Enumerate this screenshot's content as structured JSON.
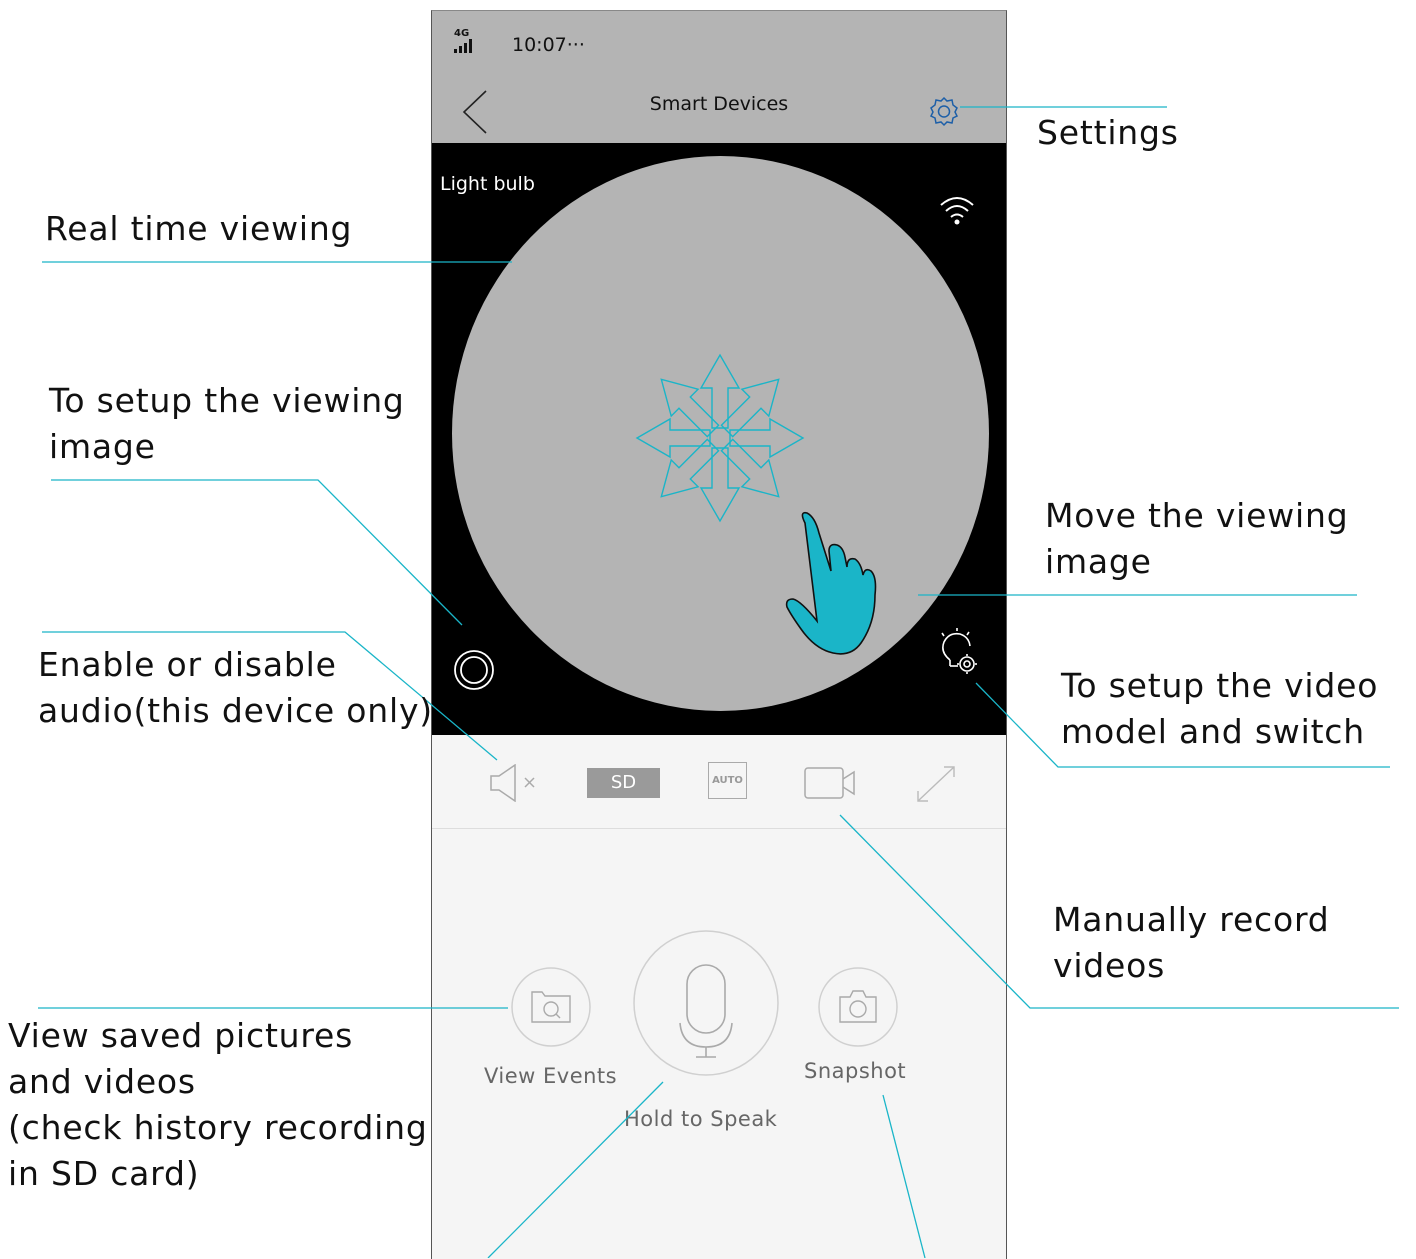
{
  "status_bar": {
    "network": "4G",
    "time": "10:07···"
  },
  "nav": {
    "title": "Smart Devices"
  },
  "video": {
    "device_name": "Light bulb"
  },
  "toolbar": {
    "sd_label": "SD",
    "auto_label": "AUTO"
  },
  "controls": {
    "view_events": "View Events",
    "hold_to_speak": "Hold to Speak",
    "snapshot": "Snapshot"
  },
  "annotations": {
    "settings": "Settings",
    "real_time": "Real time viewing",
    "setup_image_1": "To setup the viewing",
    "setup_image_2": "image",
    "audio_1": "Enable or disable",
    "audio_2": "audio(this device only)",
    "move_1": "Move the viewing",
    "move_2": "image",
    "video_model_1": "To setup the video",
    "video_model_2": "model and switch",
    "record_1": "Manually record",
    "record_2": "videos",
    "saved_1": "View saved pictures",
    "saved_2": "and videos",
    "saved_3": "(check history recording",
    "saved_4": "in SD card)"
  },
  "colors": {
    "accent": "#1ab5c8",
    "header_gray": "#b4b4b4",
    "video_bg": "#000000"
  }
}
